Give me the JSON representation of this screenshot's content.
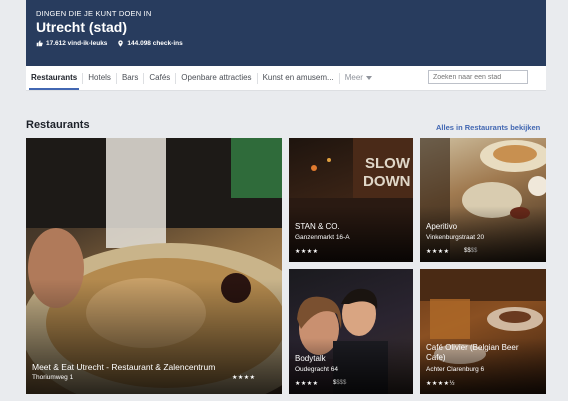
{
  "header": {
    "kicker": "DINGEN DIE JE KUNT DOEN IN",
    "city": "Utrecht (stad)",
    "likes": "17.612 vind-ik-leuks",
    "checkins": "144.098 check-ins"
  },
  "tabs": [
    "Restaurants",
    "Hotels",
    "Bars",
    "Cafés",
    "Openbare attracties",
    "Kunst en amusem...",
    "Meer"
  ],
  "search": {
    "placeholder": "Zoeken naar een stad"
  },
  "section": {
    "title": "Restaurants",
    "see_all": "Alles in Restaurants bekijken"
  },
  "cards": [
    {
      "name": "Meet & Eat Utrecht - Restaurant & Zalencentrum",
      "address": "Thoriumweg 1",
      "stars": "★★★★",
      "price": "",
      "price_dim": ""
    },
    {
      "name": "STAN & CO.",
      "address": "Ganzenmarkt 16-A",
      "stars": "★★★★",
      "price": "",
      "price_dim": ""
    },
    {
      "name": "Aperitivo",
      "address": "Vinkenburgstraat 20",
      "stars": "★★★★",
      "price": "$$",
      "price_dim": "$$"
    },
    {
      "name": "Bodytalk",
      "address": "Oudegracht 64",
      "stars": "★★★★",
      "price": "$",
      "price_dim": "$$$"
    },
    {
      "name": "Café Olivier (Belgian Beer Cafe)",
      "address": "Achter Clarenburg 6",
      "stars": "★★★★½",
      "price": "",
      "price_dim": ""
    }
  ],
  "colors": {
    "header_bg": "#283c5e",
    "link": "#4267b2",
    "page_bg": "#e9ebee"
  }
}
